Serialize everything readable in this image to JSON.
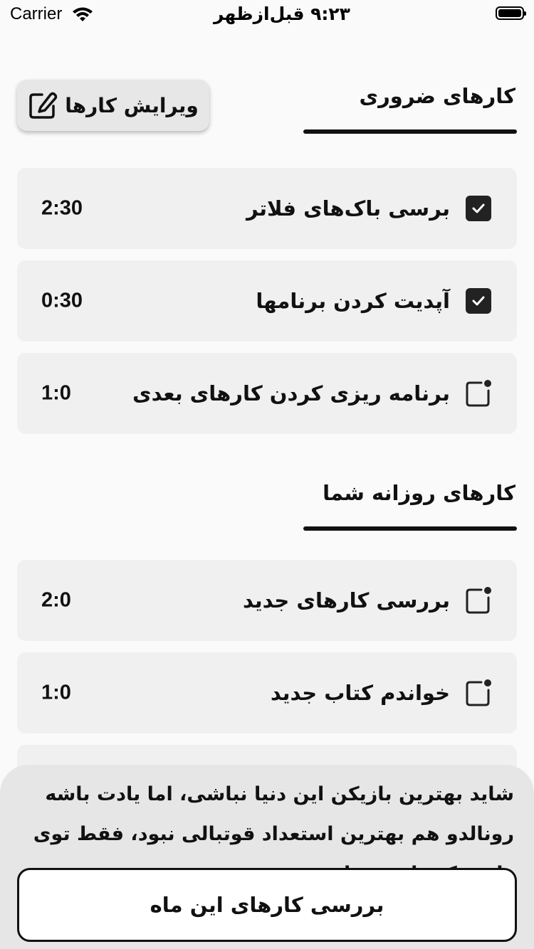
{
  "status_bar": {
    "carrier": "Carrier",
    "time": "۹:۲۳ قبل‌ازظهر"
  },
  "essential": {
    "title": "کارهای ضروری",
    "edit_button": "ویرایش کارها",
    "tasks": [
      {
        "label": "برسی باک‌های فلاتر",
        "time": "2:30",
        "done": true
      },
      {
        "label": "آپدیت کردن برنامها",
        "time": "0:30",
        "done": true
      },
      {
        "label": "برنامه ریزی کردن کارهای بعدی",
        "time": "1:0",
        "done": false
      }
    ]
  },
  "daily": {
    "title": "کارهای روزانه شما",
    "tasks": [
      {
        "label": "بررسی کارهای جدید",
        "time": "2:0",
        "done": false
      },
      {
        "label": "خواندم کتاب جدید",
        "time": "1:0",
        "done": false
      }
    ]
  },
  "bottom_sheet": {
    "quote": "شاید بهترین بازیکن این دنیا نباشی، اما یادت باشه رونالدو هم بهترین استعداد قوتبالی نبود، فقط توی راهی که داشت جا نزد.",
    "month_button": "بررسی کارهای این ماه"
  },
  "colors": {
    "background": "#fafafa",
    "card": "#f0f0f0",
    "accent": "#222222"
  }
}
